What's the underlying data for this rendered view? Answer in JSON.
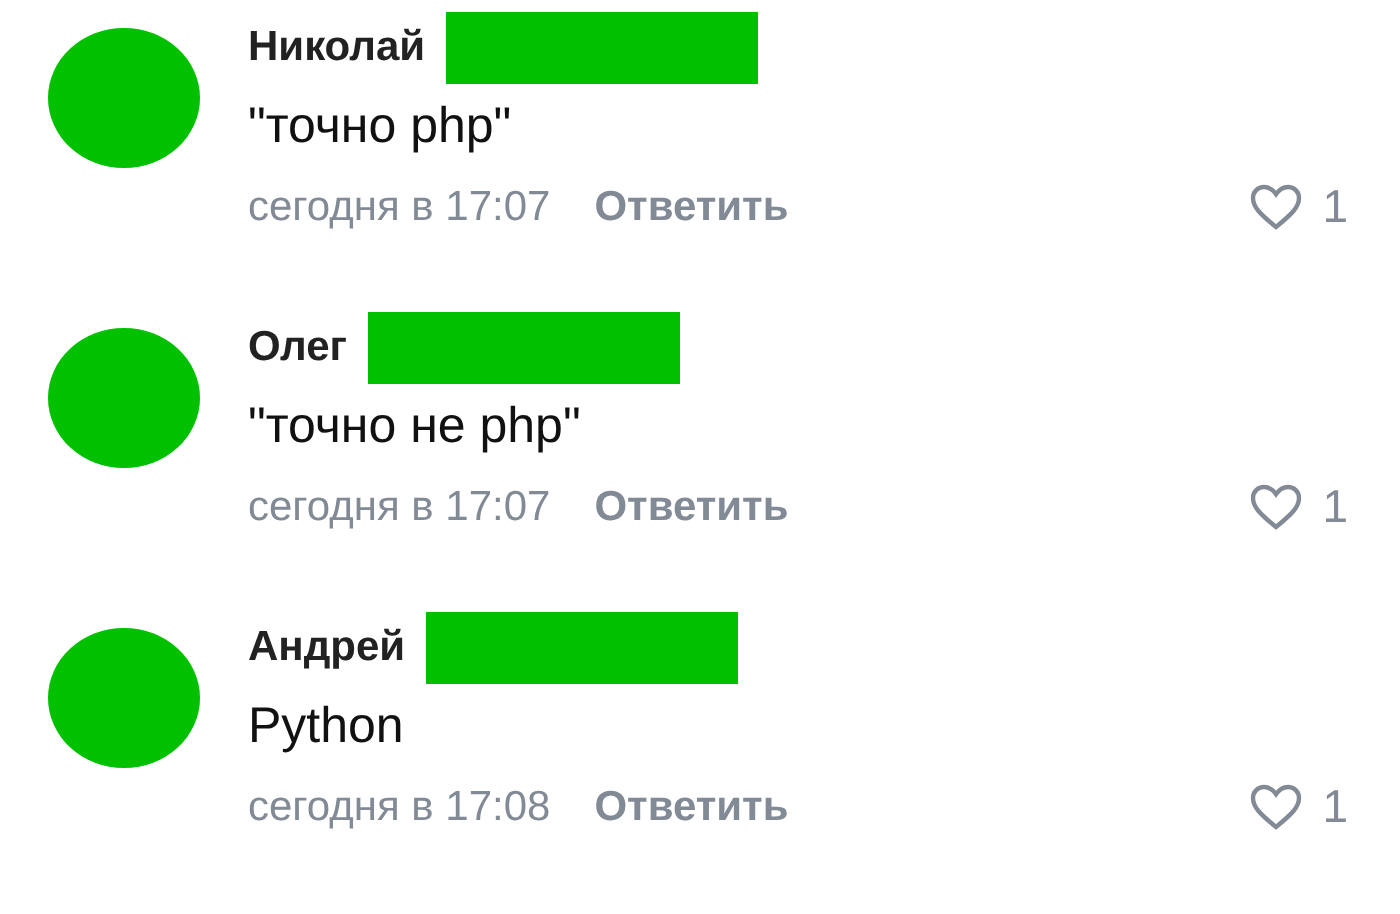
{
  "comments": [
    {
      "author": "Николай",
      "surname_redacted": true,
      "text": "\"точно php\"",
      "time": "сегодня в 17:07",
      "reply": "Ответить",
      "liked": false,
      "likes": "1"
    },
    {
      "author": "Олег",
      "surname_redacted": true,
      "text": "\"точно не php\"",
      "time": "сегодня в 17:07",
      "reply": "Ответить",
      "liked": false,
      "likes": "1"
    },
    {
      "author": "Андрей",
      "surname_redacted": true,
      "text": "Python",
      "time": "сегодня в 17:08",
      "reply": "Ответить",
      "liked": false,
      "likes": "1"
    }
  ]
}
